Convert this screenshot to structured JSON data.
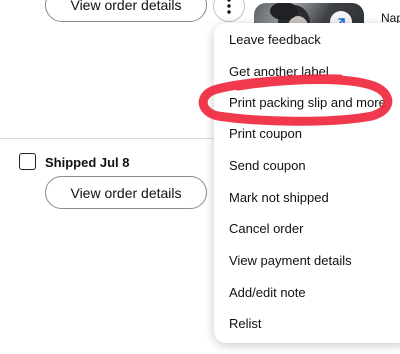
{
  "order_top": {
    "view_details_label": "View order details"
  },
  "product": {
    "link_text": "Nap"
  },
  "order_shipped": {
    "status_label": "Shipped Jul 8",
    "view_details_label": "View order details"
  },
  "menu": {
    "items": [
      {
        "label": "Leave feedback"
      },
      {
        "label": "Get another label"
      },
      {
        "label": "Print packing slip and more",
        "highlighted": true
      },
      {
        "label": "Print coupon"
      },
      {
        "label": "Send coupon"
      },
      {
        "label": "Mark not shipped"
      },
      {
        "label": "Cancel order"
      },
      {
        "label": "View payment details"
      },
      {
        "label": "Add/edit note"
      },
      {
        "label": "Relist"
      }
    ]
  },
  "colors": {
    "highlight_marker": "#f0233a",
    "menu_background": "#ffffff",
    "button_border": "#8a8a8a"
  },
  "icons": {
    "more": "vertical-ellipsis",
    "thumbnail_badge": "expand-arrow"
  }
}
